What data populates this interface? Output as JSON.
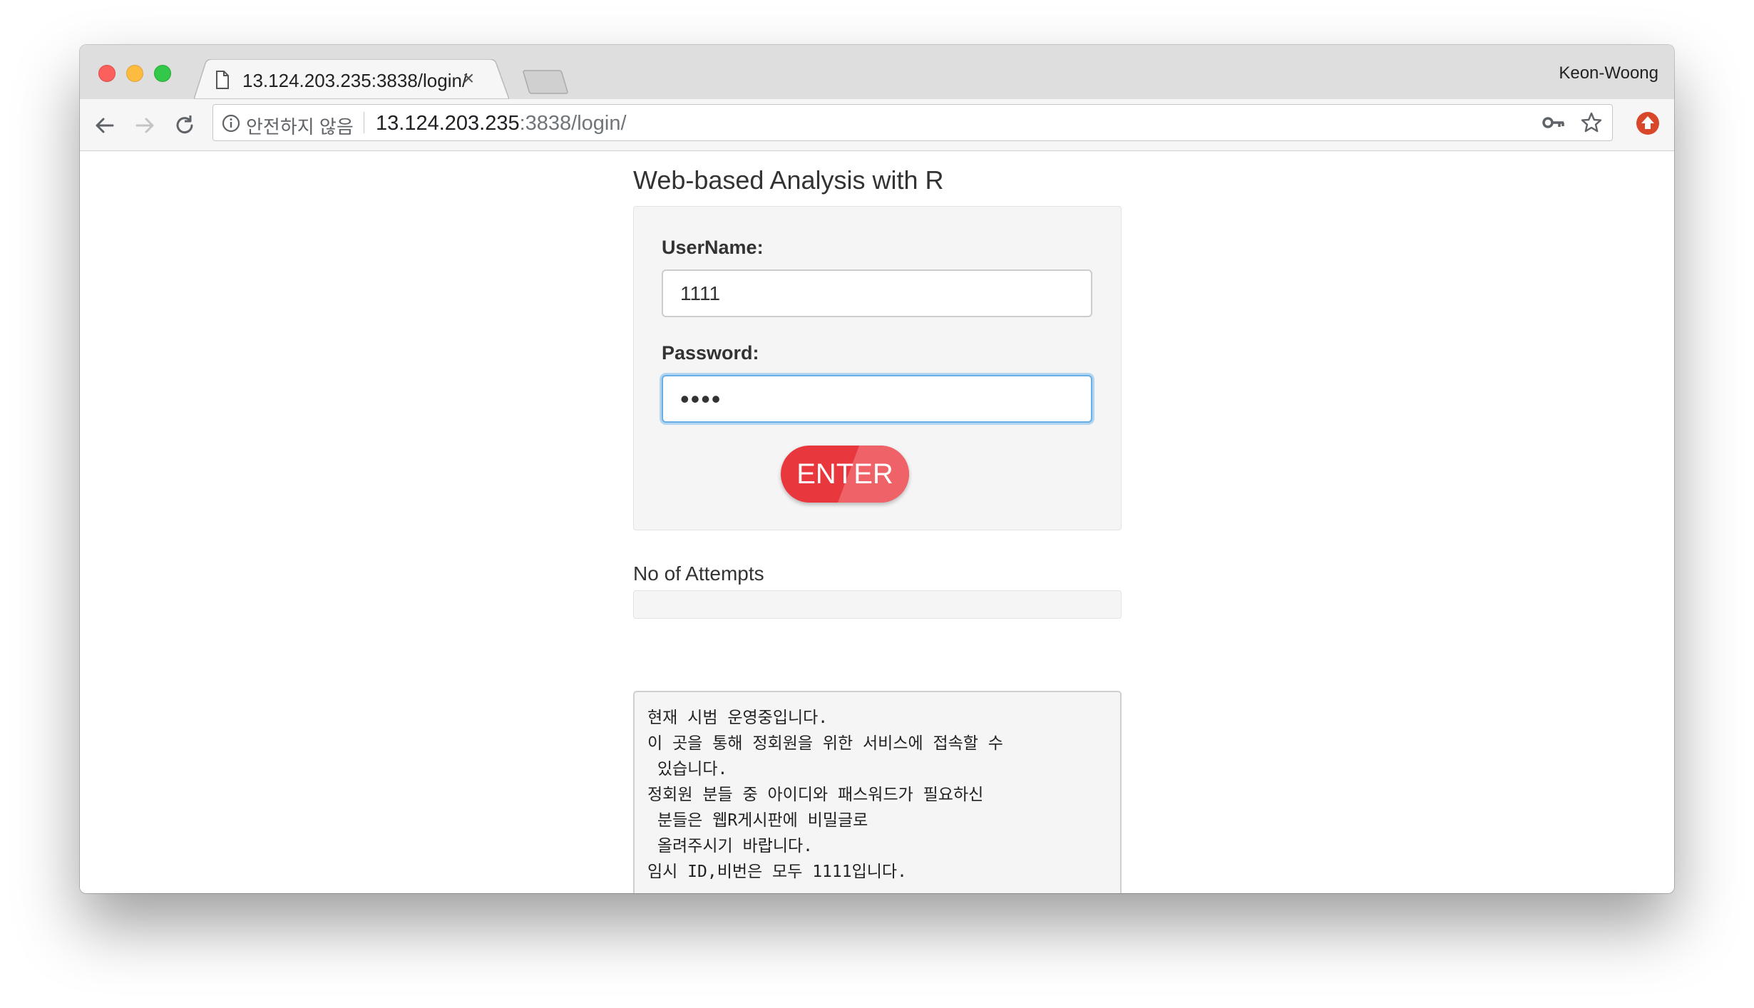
{
  "tab": {
    "title": "13.124.203.235:3838/login/",
    "close_symbol": "×"
  },
  "profile": {
    "name": "Keon-Woong"
  },
  "omnibox": {
    "security_text": "안전하지 않음",
    "url_host": "13.124.203.235",
    "url_rest": ":3838/login/"
  },
  "page": {
    "title": "Web-based Analysis with R",
    "username_label": "UserName:",
    "username_value": "1111",
    "password_label": "Password:",
    "password_mask": "••••",
    "enter_label": "ENTER",
    "attempts_label": "No of Attempts",
    "notice_lines": [
      "현재 시범 운영중입니다.",
      "이 곳을 통해 정회원을 위한 서비스에 접속할 수",
      " 있습니다.",
      "정회원 분들 중 아이디와 패스워드가 필요하신",
      " 분들은 웹R게시판에 비밀글로",
      " 올려주시기 바랍니다.",
      "임시 ID,비번은 모두 1111입니다."
    ]
  },
  "colors": {
    "enter_button": "#e8383d",
    "focus_border": "#66afe9",
    "well_background": "#f5f5f5"
  },
  "icons": [
    "page-icon",
    "close-icon",
    "back-arrow-icon",
    "forward-arrow-icon",
    "reload-icon",
    "info-icon",
    "key-icon",
    "star-icon",
    "extension-icon"
  ]
}
